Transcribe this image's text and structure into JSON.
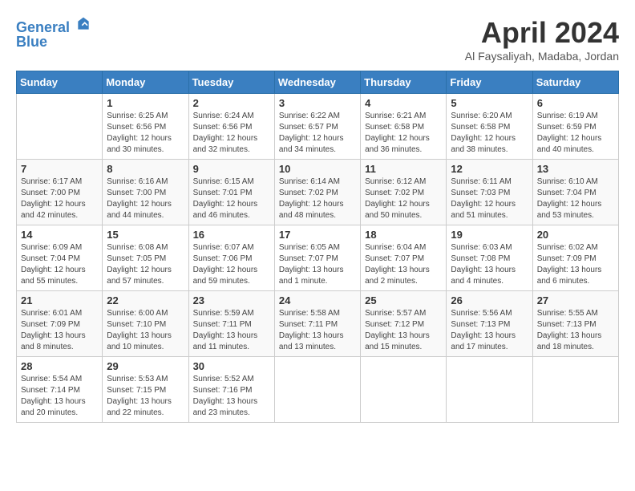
{
  "header": {
    "logo_line1": "General",
    "logo_line2": "Blue",
    "month_title": "April 2024",
    "location": "Al Faysaliyah, Madaba, Jordan"
  },
  "weekdays": [
    "Sunday",
    "Monday",
    "Tuesday",
    "Wednesday",
    "Thursday",
    "Friday",
    "Saturday"
  ],
  "weeks": [
    [
      {
        "day": "",
        "info": ""
      },
      {
        "day": "1",
        "info": "Sunrise: 6:25 AM\nSunset: 6:56 PM\nDaylight: 12 hours\nand 30 minutes."
      },
      {
        "day": "2",
        "info": "Sunrise: 6:24 AM\nSunset: 6:56 PM\nDaylight: 12 hours\nand 32 minutes."
      },
      {
        "day": "3",
        "info": "Sunrise: 6:22 AM\nSunset: 6:57 PM\nDaylight: 12 hours\nand 34 minutes."
      },
      {
        "day": "4",
        "info": "Sunrise: 6:21 AM\nSunset: 6:58 PM\nDaylight: 12 hours\nand 36 minutes."
      },
      {
        "day": "5",
        "info": "Sunrise: 6:20 AM\nSunset: 6:58 PM\nDaylight: 12 hours\nand 38 minutes."
      },
      {
        "day": "6",
        "info": "Sunrise: 6:19 AM\nSunset: 6:59 PM\nDaylight: 12 hours\nand 40 minutes."
      }
    ],
    [
      {
        "day": "7",
        "info": "Sunrise: 6:17 AM\nSunset: 7:00 PM\nDaylight: 12 hours\nand 42 minutes."
      },
      {
        "day": "8",
        "info": "Sunrise: 6:16 AM\nSunset: 7:00 PM\nDaylight: 12 hours\nand 44 minutes."
      },
      {
        "day": "9",
        "info": "Sunrise: 6:15 AM\nSunset: 7:01 PM\nDaylight: 12 hours\nand 46 minutes."
      },
      {
        "day": "10",
        "info": "Sunrise: 6:14 AM\nSunset: 7:02 PM\nDaylight: 12 hours\nand 48 minutes."
      },
      {
        "day": "11",
        "info": "Sunrise: 6:12 AM\nSunset: 7:02 PM\nDaylight: 12 hours\nand 50 minutes."
      },
      {
        "day": "12",
        "info": "Sunrise: 6:11 AM\nSunset: 7:03 PM\nDaylight: 12 hours\nand 51 minutes."
      },
      {
        "day": "13",
        "info": "Sunrise: 6:10 AM\nSunset: 7:04 PM\nDaylight: 12 hours\nand 53 minutes."
      }
    ],
    [
      {
        "day": "14",
        "info": "Sunrise: 6:09 AM\nSunset: 7:04 PM\nDaylight: 12 hours\nand 55 minutes."
      },
      {
        "day": "15",
        "info": "Sunrise: 6:08 AM\nSunset: 7:05 PM\nDaylight: 12 hours\nand 57 minutes."
      },
      {
        "day": "16",
        "info": "Sunrise: 6:07 AM\nSunset: 7:06 PM\nDaylight: 12 hours\nand 59 minutes."
      },
      {
        "day": "17",
        "info": "Sunrise: 6:05 AM\nSunset: 7:07 PM\nDaylight: 13 hours\nand 1 minute."
      },
      {
        "day": "18",
        "info": "Sunrise: 6:04 AM\nSunset: 7:07 PM\nDaylight: 13 hours\nand 2 minutes."
      },
      {
        "day": "19",
        "info": "Sunrise: 6:03 AM\nSunset: 7:08 PM\nDaylight: 13 hours\nand 4 minutes."
      },
      {
        "day": "20",
        "info": "Sunrise: 6:02 AM\nSunset: 7:09 PM\nDaylight: 13 hours\nand 6 minutes."
      }
    ],
    [
      {
        "day": "21",
        "info": "Sunrise: 6:01 AM\nSunset: 7:09 PM\nDaylight: 13 hours\nand 8 minutes."
      },
      {
        "day": "22",
        "info": "Sunrise: 6:00 AM\nSunset: 7:10 PM\nDaylight: 13 hours\nand 10 minutes."
      },
      {
        "day": "23",
        "info": "Sunrise: 5:59 AM\nSunset: 7:11 PM\nDaylight: 13 hours\nand 11 minutes."
      },
      {
        "day": "24",
        "info": "Sunrise: 5:58 AM\nSunset: 7:11 PM\nDaylight: 13 hours\nand 13 minutes."
      },
      {
        "day": "25",
        "info": "Sunrise: 5:57 AM\nSunset: 7:12 PM\nDaylight: 13 hours\nand 15 minutes."
      },
      {
        "day": "26",
        "info": "Sunrise: 5:56 AM\nSunset: 7:13 PM\nDaylight: 13 hours\nand 17 minutes."
      },
      {
        "day": "27",
        "info": "Sunrise: 5:55 AM\nSunset: 7:13 PM\nDaylight: 13 hours\nand 18 minutes."
      }
    ],
    [
      {
        "day": "28",
        "info": "Sunrise: 5:54 AM\nSunset: 7:14 PM\nDaylight: 13 hours\nand 20 minutes."
      },
      {
        "day": "29",
        "info": "Sunrise: 5:53 AM\nSunset: 7:15 PM\nDaylight: 13 hours\nand 22 minutes."
      },
      {
        "day": "30",
        "info": "Sunrise: 5:52 AM\nSunset: 7:16 PM\nDaylight: 13 hours\nand 23 minutes."
      },
      {
        "day": "",
        "info": ""
      },
      {
        "day": "",
        "info": ""
      },
      {
        "day": "",
        "info": ""
      },
      {
        "day": "",
        "info": ""
      }
    ]
  ]
}
